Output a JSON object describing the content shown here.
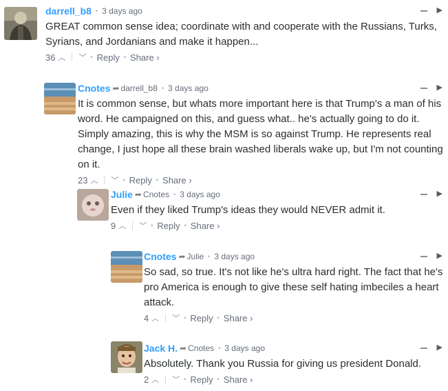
{
  "comments": [
    {
      "author": "darrell_b8",
      "parent": "",
      "time": "3 days ago",
      "text": "GREAT common sense idea; coordinate with and cooperate with the Russians, Turks, Syrians, and Jordanians and make it happen...",
      "votes": "36",
      "reply_label": "Reply",
      "share_label": "Share ›"
    },
    {
      "author": "Cnotes",
      "parent": "darrell_b8",
      "time": "3 days ago",
      "text": "It is common sense, but whats more important here is that Trump's a man of his word. He campaigned on this, and guess what.. he's actually going to do it. Simply amazing, this is why the MSM is so against Trump. He represents real change, I just hope all these brain washed liberals wake up, but I'm not counting on it.",
      "votes": "23",
      "reply_label": "Reply",
      "share_label": "Share ›"
    },
    {
      "author": "Julie",
      "parent": "Cnotes",
      "time": "3 days ago",
      "text": "Even if they liked Trump's ideas they would NEVER admit it.",
      "votes": "9",
      "reply_label": "Reply",
      "share_label": "Share ›"
    },
    {
      "author": "Cnotes",
      "parent": "Julie",
      "time": "3 days ago",
      "text": "So sad, so true. It's not like he's ultra hard right. The fact that he's pro America is enough to give these self hating imbeciles a heart attack.",
      "votes": "4",
      "reply_label": "Reply",
      "share_label": "Share ›"
    },
    {
      "author": "Jack H.",
      "parent": "Cnotes",
      "time": "3 days ago",
      "text": "Absolutely. Thank you Russia for giving us president Donald.",
      "votes": "2",
      "reply_label": "Reply",
      "share_label": "Share ›"
    }
  ],
  "icons": {
    "reply_arrow": "reply-arrow-icon",
    "upvote": "chevron-up-icon",
    "downvote": "chevron-down-icon",
    "collapse": "collapse-icon",
    "flag": "flag-icon"
  },
  "colors": {
    "author": "#2e9fff",
    "text": "#2a2e2e",
    "meta": "#656c7a"
  }
}
